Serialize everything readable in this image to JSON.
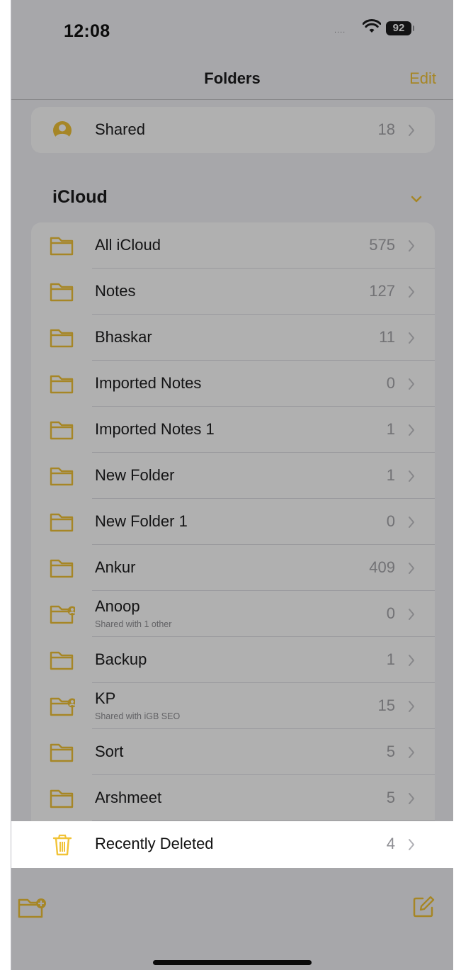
{
  "status_bar": {
    "time": "12:08",
    "signal": "....",
    "battery": "92"
  },
  "nav": {
    "title": "Folders",
    "edit_label": "Edit"
  },
  "shared": {
    "label": "Shared",
    "count": "18"
  },
  "section": {
    "title": "iCloud"
  },
  "folders": [
    {
      "label": "All iCloud",
      "count": "575"
    },
    {
      "label": "Notes",
      "count": "127"
    },
    {
      "label": "Bhaskar",
      "count": "11"
    },
    {
      "label": "Imported Notes",
      "count": "0"
    },
    {
      "label": "Imported Notes 1",
      "count": "1"
    },
    {
      "label": "New Folder",
      "count": "1"
    },
    {
      "label": "New Folder 1",
      "count": "0"
    },
    {
      "label": "Ankur",
      "count": "409"
    },
    {
      "label": "Anoop",
      "subtitle": "Shared with 1 other",
      "count": "0",
      "icon": "shared-folder-icon"
    },
    {
      "label": "Backup",
      "count": "1"
    },
    {
      "label": "KP",
      "subtitle": "Shared with iGB SEO",
      "count": "15",
      "icon": "shared-folder-icon"
    },
    {
      "label": "Sort",
      "count": "5"
    },
    {
      "label": "Arshmeet",
      "count": "5"
    }
  ],
  "recently_deleted": {
    "label": "Recently Deleted",
    "count": "4"
  },
  "colors": {
    "accent": "#f1c337",
    "background": "#f2f2f7",
    "dim_overlay": "rgba(0,0,0,0.31)"
  },
  "toolbar": {
    "left_icon": "new-folder-icon",
    "right_icon": "compose-icon"
  }
}
